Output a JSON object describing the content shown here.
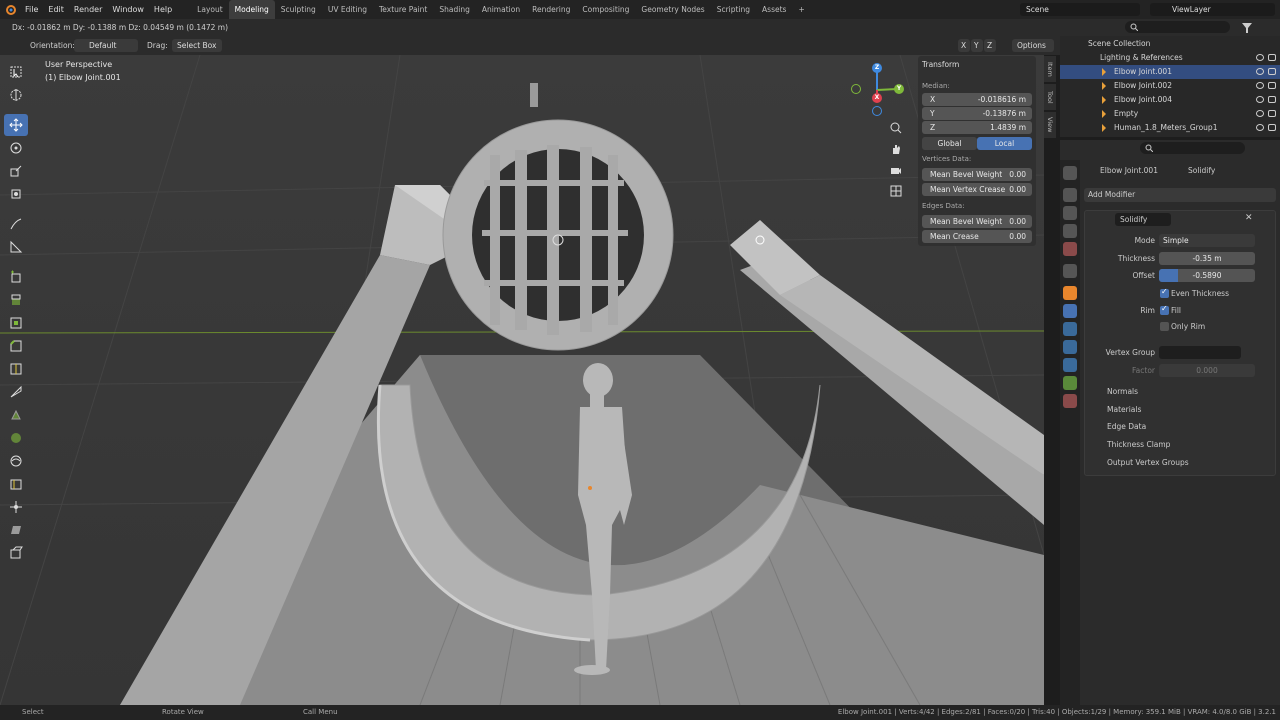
{
  "menu": [
    "File",
    "Edit",
    "Render",
    "Window",
    "Help"
  ],
  "workspaces": [
    "Layout",
    "Modeling",
    "Sculpting",
    "UV Editing",
    "Texture Paint",
    "Shading",
    "Animation",
    "Rendering",
    "Compositing",
    "Geometry Nodes",
    "Scripting",
    "Assets"
  ],
  "active_workspace": "Modeling",
  "add_tab": "+",
  "scene": "Scene",
  "viewlayer": "ViewLayer",
  "transform_readout": "Dx: -0.01862 m  Dy: -0.1388 m  Dz: 0.04549 m (0.1472 m)",
  "orientation_label": "Orientation:",
  "orientation_value": "Default",
  "drag_label": "Drag:",
  "drag_value": "Select Box",
  "axis_x": "X",
  "axis_y": "Y",
  "axis_z": "Z",
  "options": "Options",
  "viewport": {
    "perspective": "User Perspective",
    "object": "(1) Elbow Joint.001"
  },
  "gizmo": {
    "x": "X",
    "y": "Y",
    "z": "Z"
  },
  "side_tabs": [
    "Item",
    "Tool",
    "View"
  ],
  "npanel": {
    "title": "Transform",
    "median": "Median:",
    "x_label": "X",
    "x_value": "-0.018616 m",
    "y_label": "Y",
    "y_value": "-0.13876 m",
    "z_label": "Z",
    "z_value": "1.4839 m",
    "global": "Global",
    "local": "Local",
    "vertices_data": "Vertices Data:",
    "mean_bevel_weight": "Mean Bevel Weight",
    "mean_bevel_weight_v": "0.00",
    "mean_vertex_crease": "Mean Vertex Crease",
    "mean_vertex_crease_v": "0.00",
    "edges_data": "Edges Data:",
    "mean_bevel_weight_e": "Mean Bevel Weight",
    "mean_bevel_weight_e_v": "0.00",
    "mean_crease": "Mean Crease",
    "mean_crease_v": "0.00"
  },
  "outliner": {
    "root": "Scene Collection",
    "collection": "Lighting & References",
    "items": [
      "Elbow Joint.001",
      "Elbow Joint.002",
      "Elbow Joint.004",
      "Empty",
      "Human_1.8_Meters_Group1"
    ]
  },
  "properties": {
    "object": "Elbow Joint.001",
    "modifier_crumb": "Solidify",
    "add_modifier": "Add Modifier",
    "modifier_name": "Solidify",
    "mode_label": "Mode",
    "mode_value": "Simple",
    "thickness_label": "Thickness",
    "thickness_value": "-0.35 m",
    "offset_label": "Offset",
    "offset_value": "-0.5890",
    "offset_fill": 0.2,
    "even_thickness": "Even Thickness",
    "rim_label": "Rim",
    "fill": "Fill",
    "only_rim": "Only Rim",
    "vertex_group_label": "Vertex Group",
    "factor_label": "Factor",
    "factor_value": "0.000",
    "subpanels": [
      "Normals",
      "Materials",
      "Edge Data",
      "Thickness Clamp",
      "Output Vertex Groups"
    ]
  },
  "status": {
    "select": "Select",
    "rotate": "Rotate View",
    "call_menu": "Call Menu",
    "stats": "Elbow Joint.001 | Verts:4/42 | Edges:2/81 | Faces:0/20 | Tris:40 | Objects:1/29 | Memory: 359.1 MiB | VRAM: 4.0/8.0 GiB | 3.2.1"
  },
  "colors": {
    "accent": "#4772b3",
    "selection": "#334d80",
    "axis_x": "#e0414f",
    "axis_y": "#7fb93a",
    "axis_z": "#3f8ae0"
  }
}
